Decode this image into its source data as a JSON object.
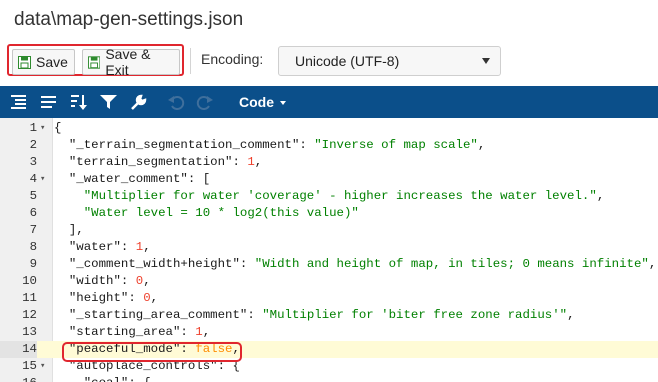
{
  "window": {
    "title": "data\\map-gen-settings.json"
  },
  "toolbar": {
    "save_label": "Save",
    "save_exit_label": "Save & Exit",
    "encoding_label": "Encoding:",
    "encoding_value": "Unicode (UTF-8)",
    "highlight_color": "#e0262e"
  },
  "json_toolbar": {
    "background": "#0b4f8a",
    "icons": [
      "format-icon",
      "compact-icon",
      "sort-icon",
      "filter-icon",
      "repair-icon",
      "undo-icon",
      "redo-icon"
    ],
    "mode_label": "Code"
  },
  "editor": {
    "active_line": 14,
    "lines": [
      {
        "n": "1",
        "fold": "▾",
        "tokens": [
          [
            "p",
            "{"
          ]
        ]
      },
      {
        "n": "2",
        "fold": "",
        "tokens": [
          [
            "k",
            "  \"_terrain_segmentation_comment\""
          ],
          [
            "p",
            ": "
          ],
          [
            "s",
            "\"Inverse of map scale\""
          ],
          [
            "p",
            ","
          ]
        ]
      },
      {
        "n": "3",
        "fold": "",
        "tokens": [
          [
            "k",
            "  \"terrain_segmentation\""
          ],
          [
            "p",
            ": "
          ],
          [
            "n",
            "1"
          ],
          [
            "p",
            ","
          ]
        ]
      },
      {
        "n": "4",
        "fold": "▾",
        "tokens": [
          [
            "k",
            "  \"_water_comment\""
          ],
          [
            "p",
            ": ["
          ]
        ]
      },
      {
        "n": "5",
        "fold": "",
        "tokens": [
          [
            "s",
            "    \"Multiplier for water 'coverage' - higher increases the water level.\""
          ],
          [
            "p",
            ","
          ]
        ]
      },
      {
        "n": "6",
        "fold": "",
        "tokens": [
          [
            "s",
            "    \"Water level = 10 * log2(this value)\""
          ]
        ]
      },
      {
        "n": "7",
        "fold": "",
        "tokens": [
          [
            "p",
            "  ],"
          ]
        ]
      },
      {
        "n": "8",
        "fold": "",
        "tokens": [
          [
            "k",
            "  \"water\""
          ],
          [
            "p",
            ": "
          ],
          [
            "n",
            "1"
          ],
          [
            "p",
            ","
          ]
        ]
      },
      {
        "n": "9",
        "fold": "",
        "tokens": [
          [
            "k",
            "  \"_comment_width+height\""
          ],
          [
            "p",
            ": "
          ],
          [
            "s",
            "\"Width and height of map, in tiles; 0 means infinite\""
          ],
          [
            "p",
            ","
          ]
        ]
      },
      {
        "n": "10",
        "fold": "",
        "tokens": [
          [
            "k",
            "  \"width\""
          ],
          [
            "p",
            ": "
          ],
          [
            "n",
            "0"
          ],
          [
            "p",
            ","
          ]
        ]
      },
      {
        "n": "11",
        "fold": "",
        "tokens": [
          [
            "k",
            "  \"height\""
          ],
          [
            "p",
            ": "
          ],
          [
            "n",
            "0"
          ],
          [
            "p",
            ","
          ]
        ]
      },
      {
        "n": "12",
        "fold": "",
        "tokens": [
          [
            "k",
            "  \"_starting_area_comment\""
          ],
          [
            "p",
            ": "
          ],
          [
            "s",
            "\"Multiplier for 'biter free zone radius'\""
          ],
          [
            "p",
            ","
          ]
        ]
      },
      {
        "n": "13",
        "fold": "",
        "tokens": [
          [
            "k",
            "  \"starting_area\""
          ],
          [
            "p",
            ": "
          ],
          [
            "n",
            "1"
          ],
          [
            "p",
            ","
          ]
        ]
      },
      {
        "n": "14",
        "fold": "",
        "tokens": [
          [
            "k",
            "  \"peaceful_mode\""
          ],
          [
            "p",
            ": "
          ],
          [
            "b",
            "false"
          ],
          [
            "p",
            ","
          ]
        ]
      },
      {
        "n": "15",
        "fold": "▾",
        "tokens": [
          [
            "k",
            "  \"autoplace_controls\""
          ],
          [
            "p",
            ": {"
          ]
        ]
      },
      {
        "n": "16",
        "fold": "",
        "tokens": [
          [
            "k",
            "    \"coal\""
          ],
          [
            "p",
            ": {"
          ]
        ]
      }
    ]
  }
}
